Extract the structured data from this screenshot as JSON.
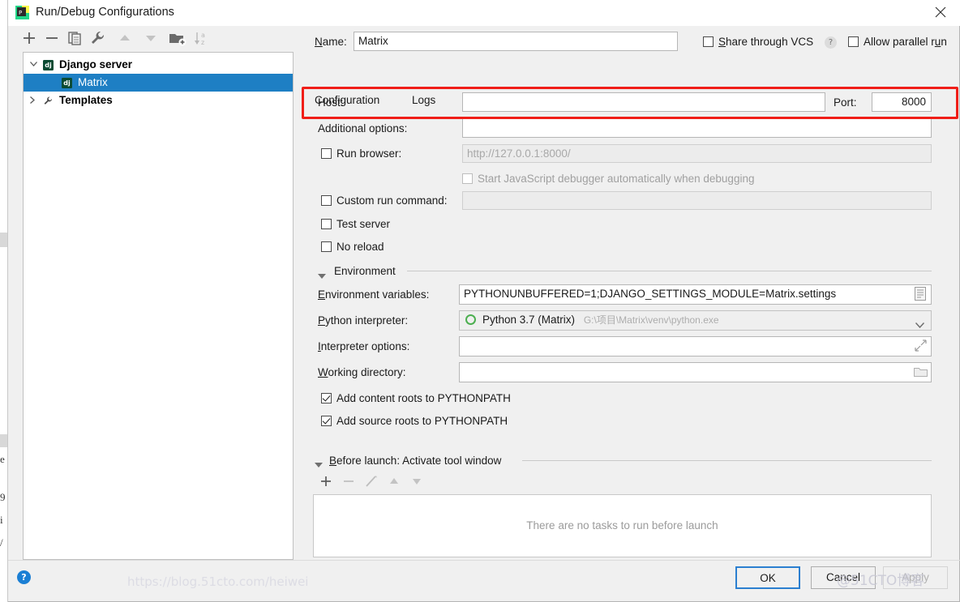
{
  "window": {
    "title": "Run/Debug Configurations",
    "app_icon": "pycharm-icon",
    "close_label": "×"
  },
  "toolbar": {
    "buttons": [
      {
        "name": "add-configuration-button",
        "glyph": "+",
        "enabled": true
      },
      {
        "name": "remove-configuration-button",
        "glyph": "−",
        "enabled": true
      },
      {
        "name": "copy-configuration-button",
        "glyph": "copy-icon",
        "enabled": true
      },
      {
        "name": "edit-templates-button",
        "glyph": "wrench-icon",
        "enabled": true
      },
      {
        "name": "move-up-button",
        "glyph": "triangle-up-icon",
        "enabled": false
      },
      {
        "name": "move-down-button",
        "glyph": "triangle-down-icon",
        "enabled": false
      },
      {
        "name": "move-into-folder-button",
        "glyph": "folder-add-icon",
        "enabled": true
      },
      {
        "name": "sort-configurations-button",
        "glyph": "sort-az-icon",
        "enabled": true
      }
    ]
  },
  "tree": {
    "items": [
      {
        "label": "Django server",
        "level": 0,
        "icon": "django-icon",
        "expander": "chevron-down",
        "bold": true,
        "selected": false
      },
      {
        "label": "Matrix",
        "level": 1,
        "icon": "django-icon",
        "expander": "none",
        "bold": false,
        "selected": true
      },
      {
        "label": "Templates",
        "level": 0,
        "icon": "wrench-icon",
        "expander": "chevron-right",
        "bold": true,
        "selected": false
      }
    ],
    "selection_color": "#1e7fc4"
  },
  "header": {
    "name_label": "Name:",
    "name_mnemonic": "N",
    "name_value": "Matrix",
    "share_vcs_label": "Share through VCS",
    "share_vcs_mnemonic": "S",
    "share_vcs_checked": false,
    "share_help_glyph": "?",
    "allow_parallel_label": "Allow parallel run",
    "allow_parallel_mnemonic": "u",
    "allow_parallel_checked": false
  },
  "tabs": [
    {
      "label": "Configuration",
      "active": true
    },
    {
      "label": "Logs",
      "active": false
    }
  ],
  "form": {
    "host_label": "Host:",
    "host_value": "",
    "port_label": "Port:",
    "port_value": "8000",
    "additional_options_label": "Additional options:",
    "additional_options_value": "",
    "run_browser_label": "Run browser:",
    "run_browser_checked": false,
    "run_browser_url_placeholder": "http://127.0.0.1:8000/",
    "js_debugger_label": "Start JavaScript debugger automatically when debugging",
    "js_debugger_checked": false,
    "custom_run_command_label": "Custom run command:",
    "custom_run_command_checked": false,
    "custom_run_command_value": "",
    "test_server_label": "Test server",
    "test_server_checked": false,
    "no_reload_label": "No reload",
    "no_reload_checked": false
  },
  "environment": {
    "section_label": "Environment",
    "expanded": true,
    "env_vars_label": "Environment variables:",
    "env_vars_mnemonic": "E",
    "env_vars_value": "PYTHONUNBUFFERED=1;DJANGO_SETTINGS_MODULE=Matrix.settings",
    "env_vars_browse_icon": "list-browse-icon",
    "interpreter_label": "Python interpreter:",
    "interpreter_mnemonic": "P",
    "interpreter_value": "Python 3.7 (Matrix)",
    "interpreter_path": "G:\\项目\\Matrix\\venv\\python.exe",
    "interpreter_dropdown_icon": "chevron-down-icon",
    "interpreter_options_label": "Interpreter options:",
    "interpreter_options_mnemonic": "I",
    "interpreter_options_value": "",
    "interpreter_options_expand_icon": "expand-icon",
    "working_directory_label": "Working directory:",
    "working_directory_mnemonic": "W",
    "working_directory_value": "",
    "working_directory_browse_icon": "folder-icon",
    "add_content_roots_label": "Add content roots to PYTHONPATH",
    "add_content_roots_checked": true,
    "add_source_roots_label": "Add source roots to PYTHONPATH",
    "add_source_roots_checked": true
  },
  "before_launch": {
    "section_label": "Before launch: Activate tool window",
    "section_mnemonic": "B",
    "expanded": true,
    "buttons": [
      {
        "name": "add-task-button",
        "glyph": "+",
        "enabled": true
      },
      {
        "name": "remove-task-button",
        "glyph": "−",
        "enabled": false
      },
      {
        "name": "edit-task-button",
        "glyph": "pencil-icon",
        "enabled": false
      },
      {
        "name": "task-move-up-button",
        "glyph": "triangle-up-icon",
        "enabled": false
      },
      {
        "name": "task-move-down-button",
        "glyph": "triangle-down-icon",
        "enabled": false
      }
    ],
    "empty_text": "There are no tasks to run before launch"
  },
  "footer": {
    "help_glyph": "?",
    "ok_label": "OK",
    "cancel_label": "Cancel",
    "apply_label": "Apply",
    "apply_enabled": false
  },
  "annotation": {
    "color": "#f01e18",
    "target": "host-port-row"
  },
  "watermark": {
    "text": "@51CTO博客",
    "url_text": "https://blog.51cto.com/heiwei"
  }
}
